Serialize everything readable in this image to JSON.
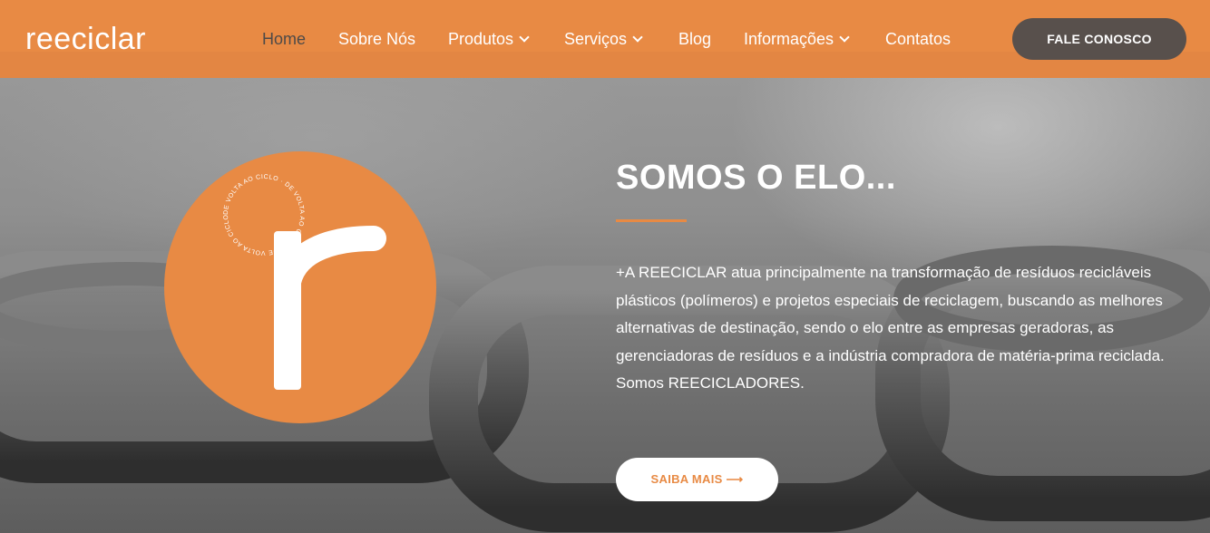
{
  "brand": {
    "logo_text": "reeciclar",
    "emblem_letter": "r",
    "emblem_ring_text": "DE VOLTA AO CICLO · DE VOLTA AO CICLO · DE VOLTA AO CICLO"
  },
  "nav": {
    "items": [
      {
        "label": "Home",
        "active": true,
        "has_dropdown": false
      },
      {
        "label": "Sobre Nós",
        "active": false,
        "has_dropdown": false
      },
      {
        "label": "Produtos",
        "active": false,
        "has_dropdown": true
      },
      {
        "label": "Serviços",
        "active": false,
        "has_dropdown": true
      },
      {
        "label": "Blog",
        "active": false,
        "has_dropdown": false
      },
      {
        "label": "Informações",
        "active": false,
        "has_dropdown": true
      },
      {
        "label": "Contatos",
        "active": false,
        "has_dropdown": false
      }
    ],
    "cta_label": "FALE CONOSCO"
  },
  "hero": {
    "headline": "SOMOS O ELO...",
    "body": "+A REECICLAR atua principalmente na transformação de resíduos recicláveis plásticos (polímeros) e projetos especiais de reciclagem, buscando as melhores alternativas de destinação, sendo o elo entre as empresas geradoras, as gerenciadoras de resíduos e a indústria compradora de matéria-prima reciclada. Somos REECICLADORES.",
    "button_label": "SAIBA MAIS",
    "button_icon": "arrow-right-icon"
  },
  "colors": {
    "accent": "#e88a44",
    "dark": "#58504c",
    "active_nav": "#4e4a48"
  }
}
